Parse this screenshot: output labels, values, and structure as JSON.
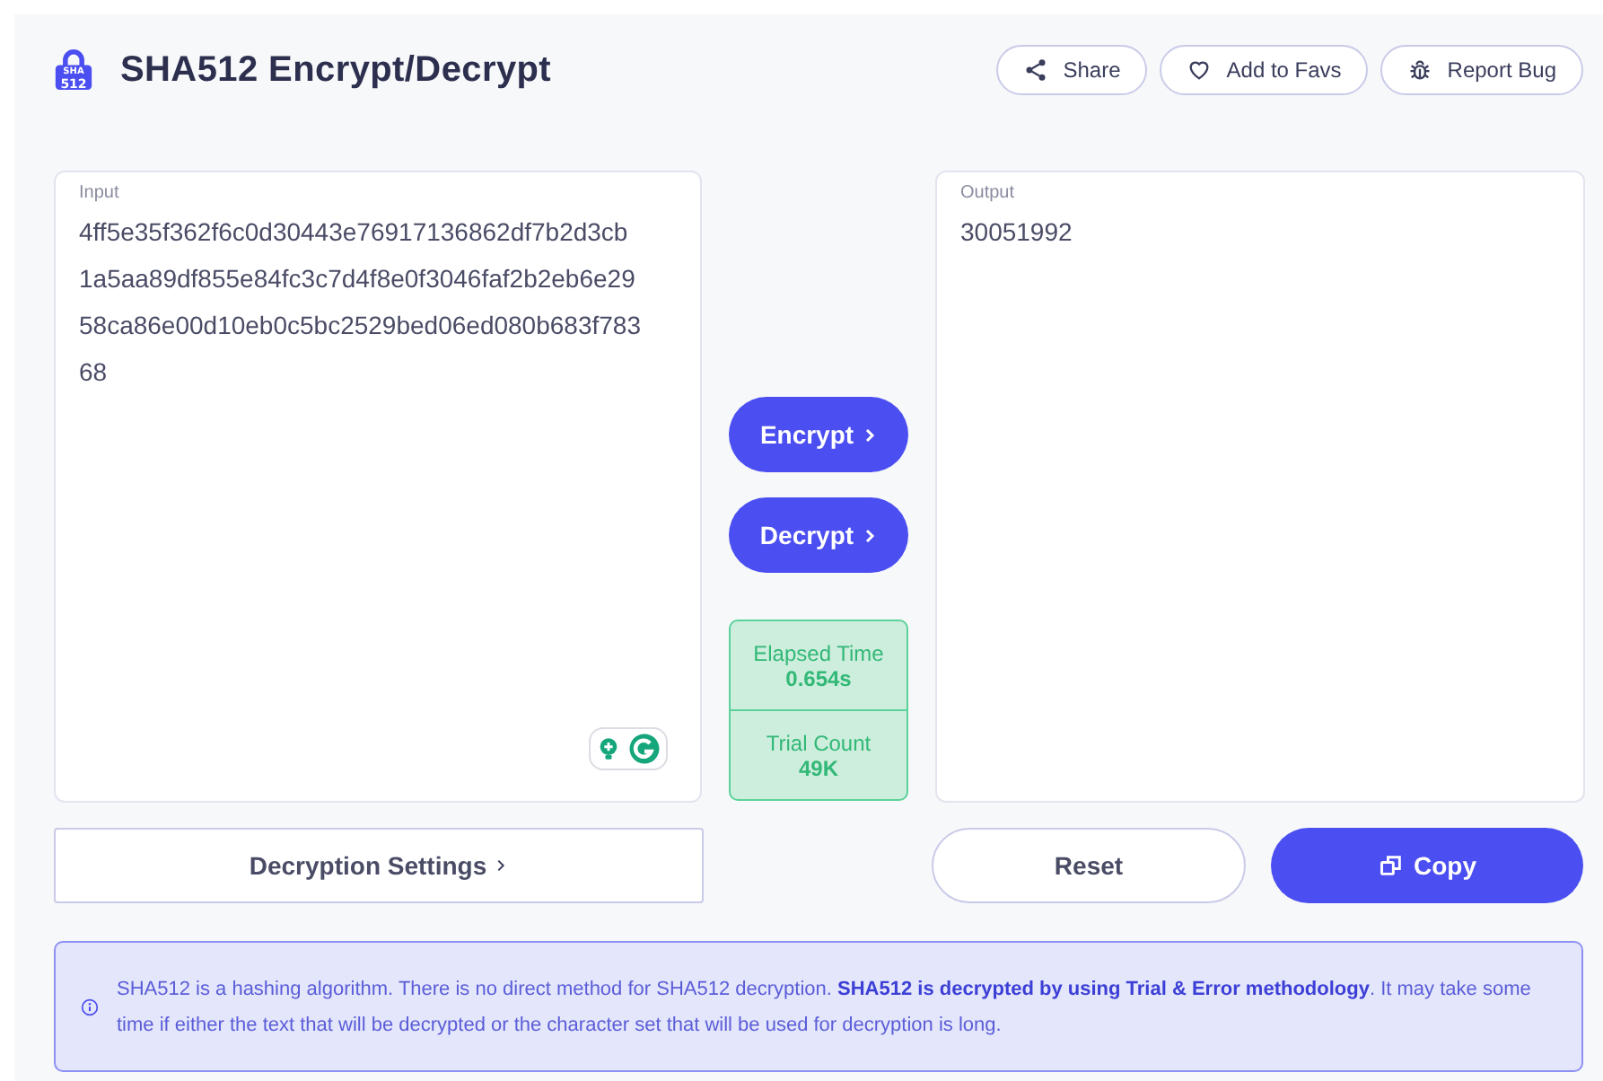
{
  "header": {
    "logo_text": [
      "SHA",
      "512"
    ],
    "title": "SHA512 Encrypt/Decrypt",
    "actions": [
      {
        "kind": "share",
        "label": "Share"
      },
      {
        "kind": "heart",
        "label": "Add to Favs"
      },
      {
        "kind": "bug",
        "label": "Report Bug"
      }
    ]
  },
  "input": {
    "label": "Input",
    "value": "4ff5e35f362f6c0d30443e76917136862df7b2d3cb1a5aa89df855e84fc3c7d4f8e0f3046faf2b2eb6e2958ca86e00d10eb0c5bc2529bed06ed080b683f78368"
  },
  "output": {
    "label": "Output",
    "value": "30051992"
  },
  "actions": [
    {
      "label": "Encrypt"
    },
    {
      "label": "Decrypt"
    }
  ],
  "stats": [
    {
      "label": "Elapsed Time",
      "value": "0.654s"
    },
    {
      "label": "Trial Count",
      "value": "49K"
    }
  ],
  "settings_button": "Decryption Settings",
  "reset_button": "Reset",
  "copy_button": "Copy",
  "info": "SHA512 is a hashing algorithm. There is no direct method for SHA512 decryption. **SHA512 is decrypted by using Trial & Error methodology**. It may take some time if either the text that will be decrypted or the character set that will be used for decryption is long."
}
